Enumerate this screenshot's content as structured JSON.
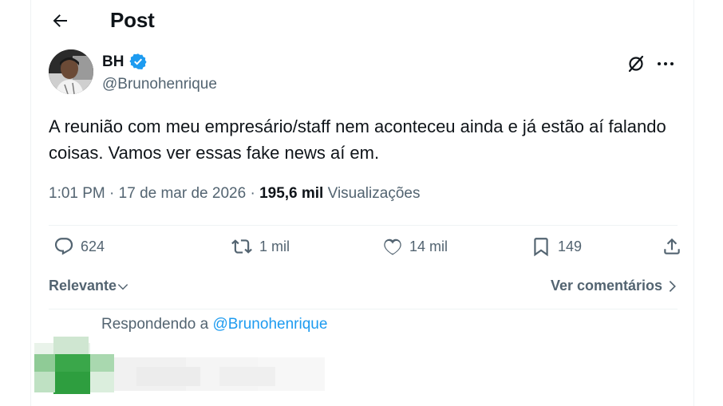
{
  "header": {
    "title": "Post"
  },
  "post": {
    "author_name": "BH",
    "author_handle": "@Brunohenrique",
    "text": "A reunião com meu empresário/staff nem aconteceu ainda e já estão aí falando coisas. Vamos ver essas fake news aí em.",
    "time": "1:01 PM",
    "separator": "·",
    "date": "17 de mar de 2026",
    "views_count": "195,6 mil",
    "views_label": "Visualizações"
  },
  "actions": {
    "replies": "624",
    "reposts": "1 mil",
    "likes": "14 mil",
    "bookmarks": "149"
  },
  "sort": {
    "label": "Relevante",
    "see_comments": "Ver comentários"
  },
  "reply_composer": {
    "prefix": "Respondendo a ",
    "mention": "@Brunohenrique"
  },
  "colors": {
    "accent": "#1d9bf0",
    "muted": "#536471",
    "text": "#0f1419",
    "divider": "#eff3f4",
    "blur_green": "#2e9e3f"
  },
  "icons": [
    "back-arrow-icon",
    "verified-badge-icon",
    "grok-icon",
    "more-icon",
    "reply-icon",
    "repost-icon",
    "like-icon",
    "bookmark-icon",
    "share-icon",
    "chevron-down-icon",
    "chevron-right-icon"
  ]
}
